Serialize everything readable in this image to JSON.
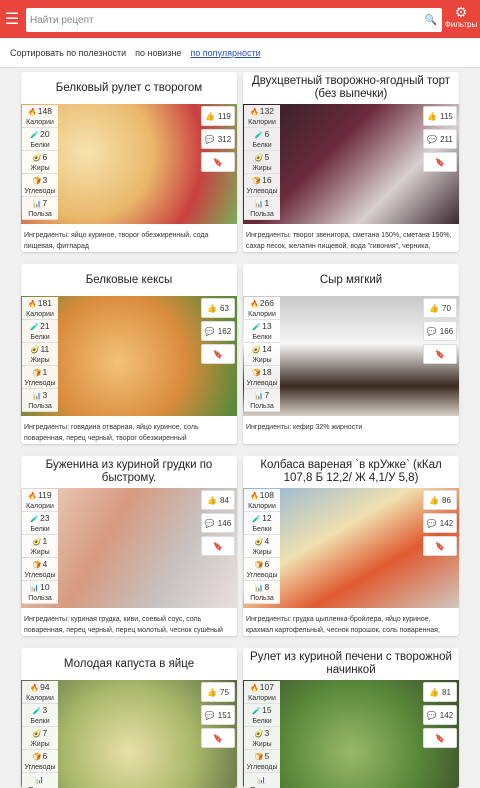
{
  "header": {
    "search_placeholder": "Найти рецепт",
    "filters_label": "Фильтры"
  },
  "sort": {
    "label": "Сортировать по полезности",
    "options": [
      "по новизне",
      "по популярности"
    ],
    "active": "по популярности"
  },
  "stat_labels": {
    "cal": "Калории",
    "prot": "Белки",
    "fat": "Жиры",
    "carb": "Углеводы",
    "use": "Польза"
  },
  "cards": [
    {
      "title": "Белковый рулет с творогом",
      "cal": "148",
      "prot": "20",
      "fat": "6",
      "carb": "3",
      "use": "7",
      "likes": "119",
      "comments": "312",
      "ingredients": "Ингредиенты: яйцо куриное, творог обезжиренный, сода пищевая, фитпарад"
    },
    {
      "title": "Двухцветный творожно-ягодный торт (без выпечки)",
      "cal": "132",
      "prot": "6",
      "fat": "5",
      "carb": "16",
      "use": "1",
      "likes": "115",
      "comments": "211",
      "ingredients": "Ингредиенты: творог звенигора, сметана 150%, сметана 150%, сахар песок, желатин пищевой, вода \"гивония\", черника, печенье мария, желатин пищевой, вода..."
    },
    {
      "title": "Белковые кексы",
      "cal": "181",
      "prot": "21",
      "fat": "11",
      "carb": "1",
      "use": "3",
      "likes": "63",
      "comments": "162",
      "ingredients": "Ингредиенты: говядина отварная, яйцо куриное, соль поваренная, перец черный, творог обезжиренный"
    },
    {
      "title": "Сыр мягкий",
      "cal": "266",
      "prot": "13",
      "fat": "14",
      "carb": "18",
      "use": "7",
      "likes": "70",
      "comments": "166",
      "ingredients": "Ингредиенты: кефир 32% жирности"
    },
    {
      "title": "Буженина из куриной грудки по быстрому.",
      "cal": "119",
      "prot": "23",
      "fat": "1",
      "carb": "4",
      "use": "10",
      "likes": "84",
      "comments": "146",
      "ingredients": "Ингредиенты: куриная грудка, киви, соевый соус, соль поваренная, перец черный, перец молотый, чеснок сушёный"
    },
    {
      "title": "Колбаса вареная `в крУжке` (кКал 107,8 Б 12,2/ Ж 4,1/У 5,8)",
      "cal": "108",
      "prot": "12",
      "fat": "4",
      "carb": "6",
      "use": "8",
      "likes": "86",
      "comments": "142",
      "ingredients": "Ингредиенты: грудка цыпленка-бройлера, яйцо куриное, крахмал картофельный, чеснок порошок, соль поваренная, перец черный, мускатный орех, паприка, пет..."
    },
    {
      "title": "Молодая капуста в яйце",
      "cal": "94",
      "prot": "3",
      "fat": "7",
      "carb": "6",
      "use": "",
      "likes": "75",
      "comments": "151",
      "ingredients": ""
    },
    {
      "title": "Рулет из куриной печени с творожной начинкой",
      "cal": "107",
      "prot": "15",
      "fat": "3",
      "carb": "5",
      "use": "",
      "likes": "81",
      "comments": "142",
      "ingredients": ""
    }
  ],
  "colors": {
    "accent": "#e8453c",
    "link": "#2a4ebf"
  }
}
